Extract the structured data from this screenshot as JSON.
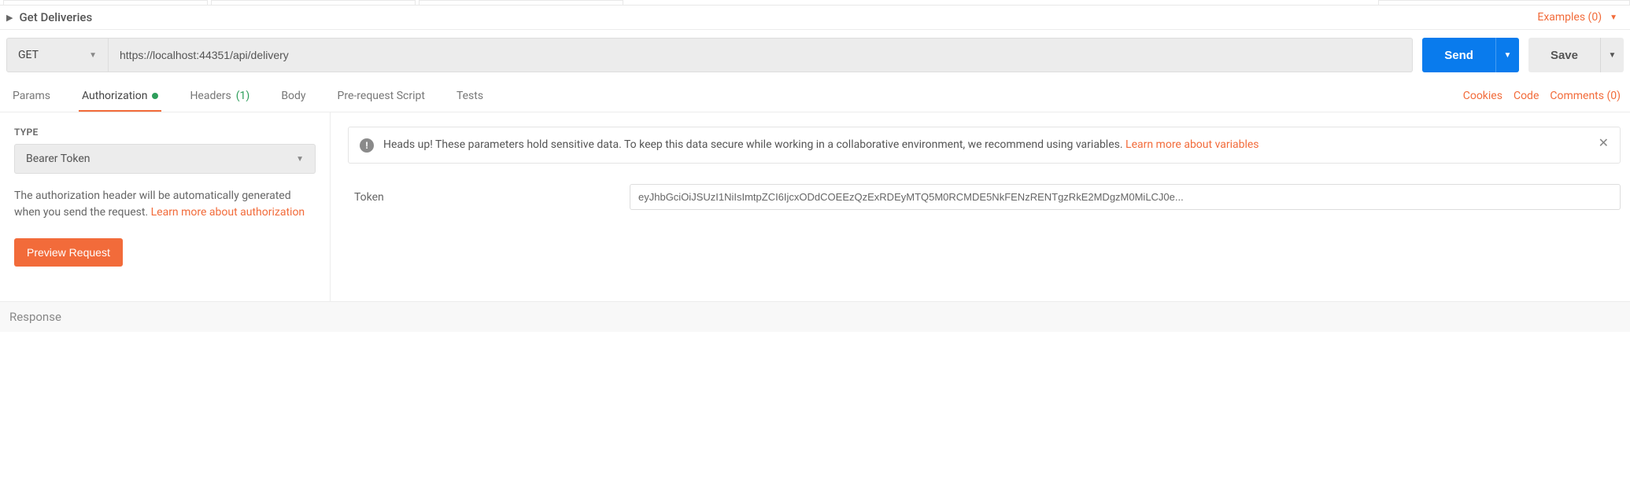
{
  "header": {
    "request_title": "Get Deliveries",
    "examples_label": "Examples (0)"
  },
  "url_row": {
    "method": "GET",
    "url": "https://localhost:44351/api/delivery",
    "send_label": "Send",
    "save_label": "Save"
  },
  "tabs": {
    "params": "Params",
    "authorization": "Authorization",
    "headers_label": "Headers",
    "headers_count": "(1)",
    "body": "Body",
    "prerequest": "Pre-request Script",
    "tests": "Tests"
  },
  "right_links": {
    "cookies": "Cookies",
    "code": "Code",
    "comments": "Comments (0)"
  },
  "auth": {
    "type_label": "TYPE",
    "type_value": "Bearer Token",
    "help_text": "The authorization header will be automatically generated when you send the request. ",
    "help_link": "Learn more about authorization",
    "preview_label": "Preview Request",
    "banner_text": "Heads up! These parameters hold sensitive data. To keep this data secure while working in a collaborative environment, we recommend using variables. ",
    "banner_link": "Learn more about variables",
    "token_label": "Token",
    "token_value": "eyJhbGciOiJSUzI1NiIsImtpZCI6IjcxODdCOEEzQzExRDEyMTQ5M0RCMDE5NkFENzRENTgzRkE2MDgzM0MiLCJ0e..."
  },
  "response": {
    "label": "Response"
  }
}
